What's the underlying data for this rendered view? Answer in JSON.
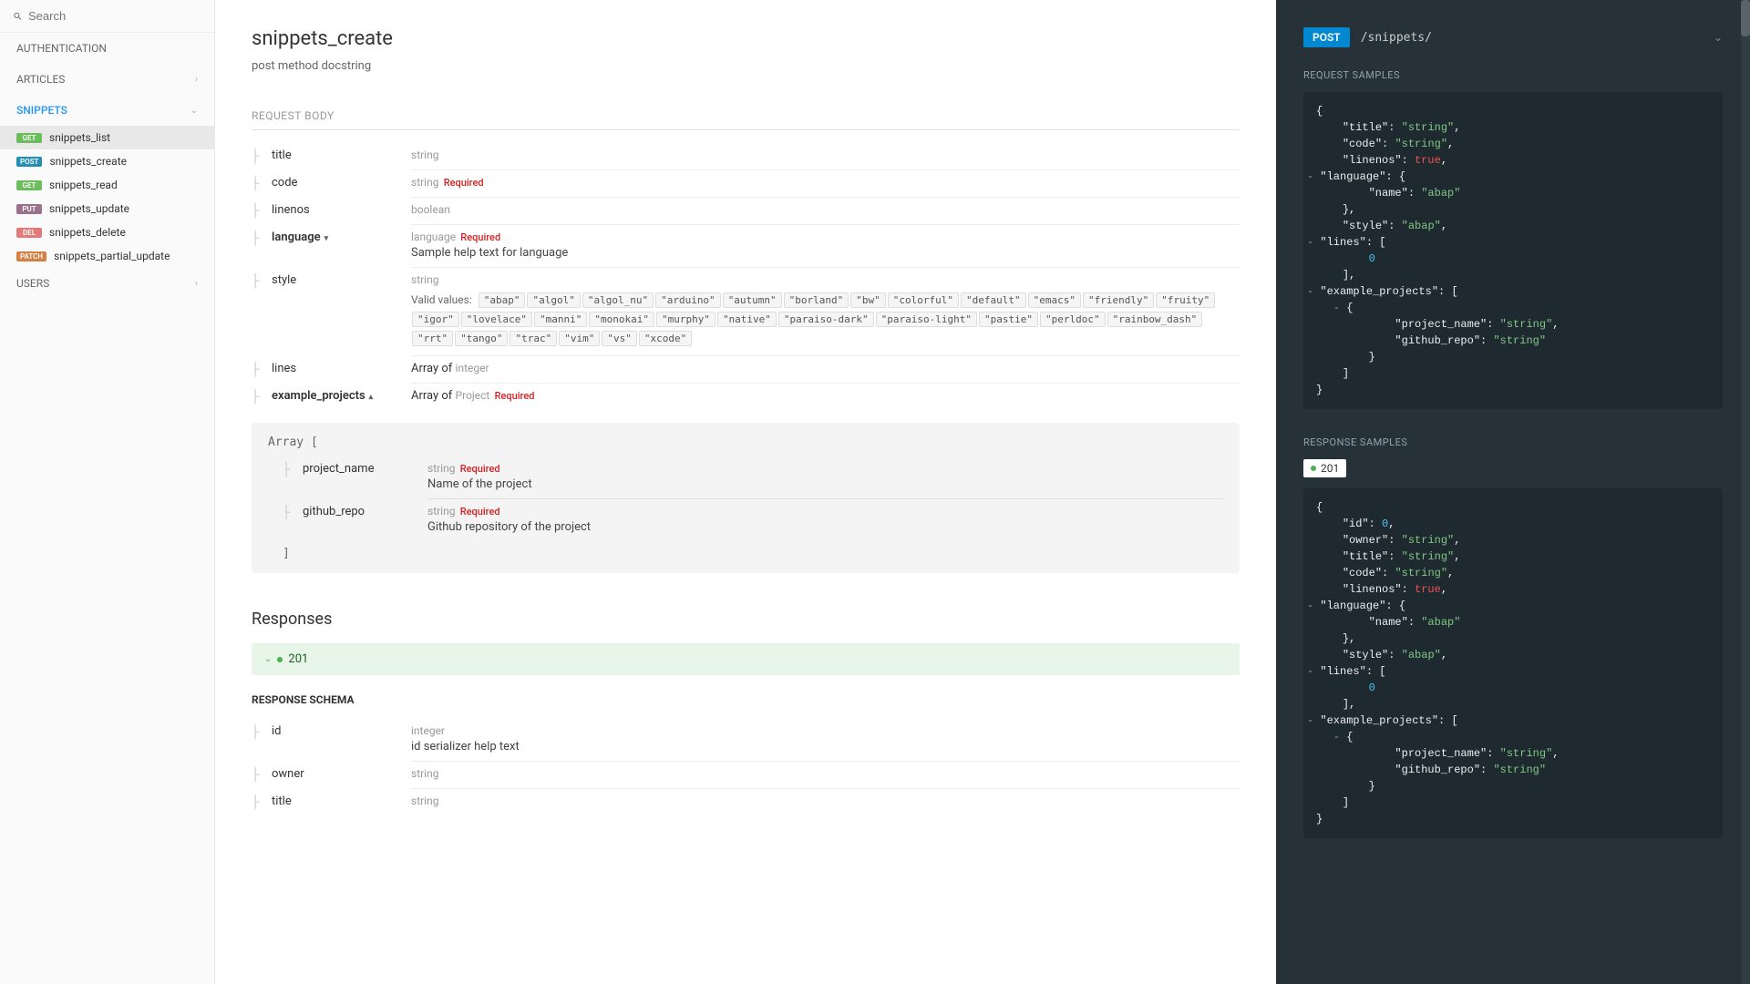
{
  "search": {
    "placeholder": "Search"
  },
  "sidebar": {
    "sections": [
      {
        "label": "AUTHENTICATION",
        "active": false,
        "expandable": false
      },
      {
        "label": "ARTICLES",
        "active": false,
        "expandable": true
      },
      {
        "label": "SNIPPETS",
        "active": true,
        "expandable": true
      },
      {
        "label": "USERS",
        "active": false,
        "expandable": true
      }
    ],
    "items": [
      {
        "method": "GET",
        "badge_class": "get",
        "label": "snippets_list",
        "selected": true
      },
      {
        "method": "POST",
        "badge_class": "post",
        "label": "snippets_create",
        "selected": false
      },
      {
        "method": "GET",
        "badge_class": "get",
        "label": "snippets_read",
        "selected": false
      },
      {
        "method": "PUT",
        "badge_class": "put",
        "label": "snippets_update",
        "selected": false
      },
      {
        "method": "DEL",
        "badge_class": "delete",
        "label": "snippets_delete",
        "selected": false
      },
      {
        "method": "PATCH",
        "badge_class": "patch",
        "label": "snippets_partial_update",
        "selected": false
      }
    ]
  },
  "page": {
    "title": "snippets_create",
    "description": "post method docstring",
    "request_body_header": "REQUEST BODY",
    "params": [
      {
        "name": "title",
        "type": "string",
        "required": false,
        "bold": false
      },
      {
        "name": "code",
        "type": "string",
        "required": true,
        "bold": false
      },
      {
        "name": "linenos",
        "type": "boolean",
        "required": false,
        "bold": false
      },
      {
        "name": "language",
        "type": "language",
        "required": true,
        "bold": true,
        "caret": "down",
        "help": "Sample help text for language"
      },
      {
        "name": "style",
        "type": "string",
        "required": false,
        "bold": false,
        "valid_values": [
          "\"abap\"",
          "\"algol\"",
          "\"algol_nu\"",
          "\"arduino\"",
          "\"autumn\"",
          "\"borland\"",
          "\"bw\"",
          "\"colorful\"",
          "\"default\"",
          "\"emacs\"",
          "\"friendly\"",
          "\"fruity\"",
          "\"igor\"",
          "\"lovelace\"",
          "\"manni\"",
          "\"monokai\"",
          "\"murphy\"",
          "\"native\"",
          "\"paraiso-dark\"",
          "\"paraiso-light\"",
          "\"pastie\"",
          "\"perldoc\"",
          "\"rainbow_dash\"",
          "\"rrt\"",
          "\"tango\"",
          "\"trac\"",
          "\"vim\"",
          "\"vs\"",
          "\"xcode\""
        ]
      },
      {
        "name": "lines",
        "type_prefix": "Array of ",
        "type": "integer",
        "required": false,
        "bold": false
      },
      {
        "name": "example_projects",
        "type_prefix": "Array of ",
        "type": "Project",
        "required": true,
        "bold": true,
        "caret": "up"
      }
    ],
    "valid_values_label": "Valid values:",
    "required_label": "Required",
    "nested": {
      "open": "Array [",
      "close": "]",
      "fields": [
        {
          "name": "project_name",
          "type": "string",
          "required": true,
          "help": "Name of the project"
        },
        {
          "name": "github_repo",
          "type": "string",
          "required": true,
          "help": "Github repository of the project"
        }
      ]
    },
    "responses_title": "Responses",
    "response_code": "201",
    "response_schema_title": "RESPONSE SCHEMA",
    "response_params": [
      {
        "name": "id",
        "type": "integer",
        "help": "id serializer help text"
      },
      {
        "name": "owner",
        "type": "string"
      },
      {
        "name": "title",
        "type": "string"
      }
    ]
  },
  "panel": {
    "method": "POST",
    "path": "/snippets/",
    "request_samples_title": "REQUEST SAMPLES",
    "response_samples_title": "RESPONSE SAMPLES",
    "status_code": "201",
    "request_json": {
      "title": "string",
      "code": "string",
      "linenos": true,
      "language": {
        "name": "abap"
      },
      "style": "abap",
      "lines": [
        0
      ],
      "example_projects": [
        {
          "project_name": "string",
          "github_repo": "string"
        }
      ]
    },
    "response_json": {
      "id": 0,
      "owner": "string",
      "title": "string",
      "code": "string",
      "linenos": true,
      "language": {
        "name": "abap"
      },
      "style": "abap",
      "lines": [
        0
      ],
      "example_projects": [
        {
          "project_name": "string",
          "github_repo": "string"
        }
      ]
    }
  }
}
